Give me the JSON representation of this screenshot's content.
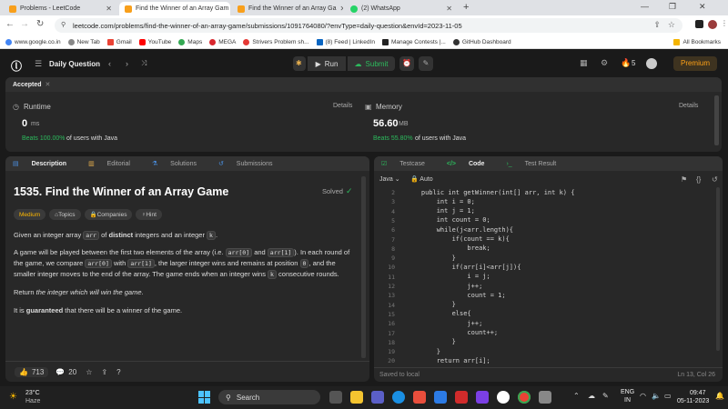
{
  "browser": {
    "tabs": [
      {
        "title": "Problems - LeetCode",
        "favicon_color": "#f89f1b"
      },
      {
        "title": "Find the Winner of an Array Gam",
        "favicon_color": "#f89f1b",
        "active": true
      },
      {
        "title": "Find the Winner of an Array Ga",
        "favicon_color": "#f89f1b"
      },
      {
        "title": "(2) WhatsApp",
        "favicon_color": "#25d366"
      }
    ],
    "url": "leetcode.com/problems/find-the-winner-of-an-array-game/submissions/1091764080/?envType=daily-question&envId=2023-11-05",
    "bookmarks": [
      {
        "label": "www.google.co.in",
        "color": "#4285f4"
      },
      {
        "label": "New Tab",
        "color": "#888888"
      },
      {
        "label": "Gmail",
        "color": "#ea4335"
      },
      {
        "label": "YouTube",
        "color": "#ff0000"
      },
      {
        "label": "Maps",
        "color": "#34a853"
      },
      {
        "label": "MEGA",
        "color": "#d9272e"
      },
      {
        "label": "Strivers Problem sh...",
        "color": "#e53935"
      },
      {
        "label": "(8) Feed | LinkedIn",
        "color": "#0a66c2"
      },
      {
        "label": "Manage Contests |...",
        "color": "#222222"
      },
      {
        "label": "GitHub Dashboard",
        "color": "#333333"
      }
    ],
    "all_bookmarks": "All Bookmarks"
  },
  "header": {
    "daily_question": "Daily Question",
    "run": "Run",
    "submit": "Submit",
    "streak": "5",
    "premium": "Premium"
  },
  "result": {
    "status": "Accepted",
    "runtime_label": "Runtime",
    "runtime_value": "0",
    "runtime_unit": "ms",
    "runtime_beats": "Beats 100.00%",
    "runtime_suffix": "of users with Java",
    "memory_label": "Memory",
    "memory_value": "56.60",
    "memory_unit": "MB",
    "memory_beats": "Beats 55.80%",
    "memory_suffix": "of users with Java",
    "details": "Details"
  },
  "left_tabs": [
    "Description",
    "Editorial",
    "Solutions",
    "Submissions"
  ],
  "problem": {
    "title": "1535. Find the Winner of an Array Game",
    "solved": "Solved",
    "tags": [
      "Medium",
      "Topics",
      "Companies",
      "Hint"
    ],
    "p1_a": "Given an integer array ",
    "p1_code1": "arr",
    "p1_b": " of ",
    "p1_bold": "distinct",
    "p1_c": " integers and an integer ",
    "p1_code2": "k",
    "p1_d": ".",
    "p2_a": "A game will be played between the first two elements of the array (i.e. ",
    "p2_code1": "arr[0]",
    "p2_b": " and ",
    "p2_code2": "arr[1]",
    "p2_c": "). In each round of the game, we compare ",
    "p2_code3": "arr[0]",
    "p2_d": " with ",
    "p2_code4": "arr[1]",
    "p2_e": ", the larger integer wins and remains at position ",
    "p2_code5": "0",
    "p2_f": ", and the smaller integer moves to the end of the array. The game ends when an integer wins ",
    "p2_code6": "k",
    "p2_g": " consecutive rounds.",
    "p3_a": "Return ",
    "p3_em": "the integer which will win the game",
    "p3_b": ".",
    "p4_a": "It is ",
    "p4_bold": "guaranteed",
    "p4_b": " that there will be a winner of the game.",
    "likes": "713",
    "comments": "20"
  },
  "right_tabs": [
    "Testcase",
    "Code",
    "Test Result"
  ],
  "editor": {
    "language": "Java",
    "mode": "Auto",
    "saved": "Saved to local",
    "cursor": "Ln 13, Col 26",
    "lines": [
      {
        "n": "2",
        "t": "    public int getWinner(int[] arr, int k) {"
      },
      {
        "n": "3",
        "t": "        int i = 0;"
      },
      {
        "n": "4",
        "t": "        int j = 1;"
      },
      {
        "n": "5",
        "t": "        int count = 0;"
      },
      {
        "n": "6",
        "t": "        while(j<arr.length){"
      },
      {
        "n": "7",
        "t": "            if(count == k){"
      },
      {
        "n": "8",
        "t": "                break;"
      },
      {
        "n": "9",
        "t": "            }"
      },
      {
        "n": "10",
        "t": "            if(arr[i]<arr[j]){"
      },
      {
        "n": "11",
        "t": "                i = j;"
      },
      {
        "n": "12",
        "t": "                j++;"
      },
      {
        "n": "13",
        "t": "                count = 1;"
      },
      {
        "n": "14",
        "t": "            }"
      },
      {
        "n": "15",
        "t": "            else{"
      },
      {
        "n": "16",
        "t": "                j++;"
      },
      {
        "n": "17",
        "t": "                count++;"
      },
      {
        "n": "18",
        "t": "            }"
      },
      {
        "n": "19",
        "t": "        }"
      },
      {
        "n": "20",
        "t": "        return arr[i];"
      }
    ]
  },
  "taskbar": {
    "temp": "23°C",
    "weather": "Haze",
    "search": "Search",
    "lang1": "ENG",
    "lang2": "IN",
    "time": "09:47",
    "date": "05-11-2023"
  }
}
